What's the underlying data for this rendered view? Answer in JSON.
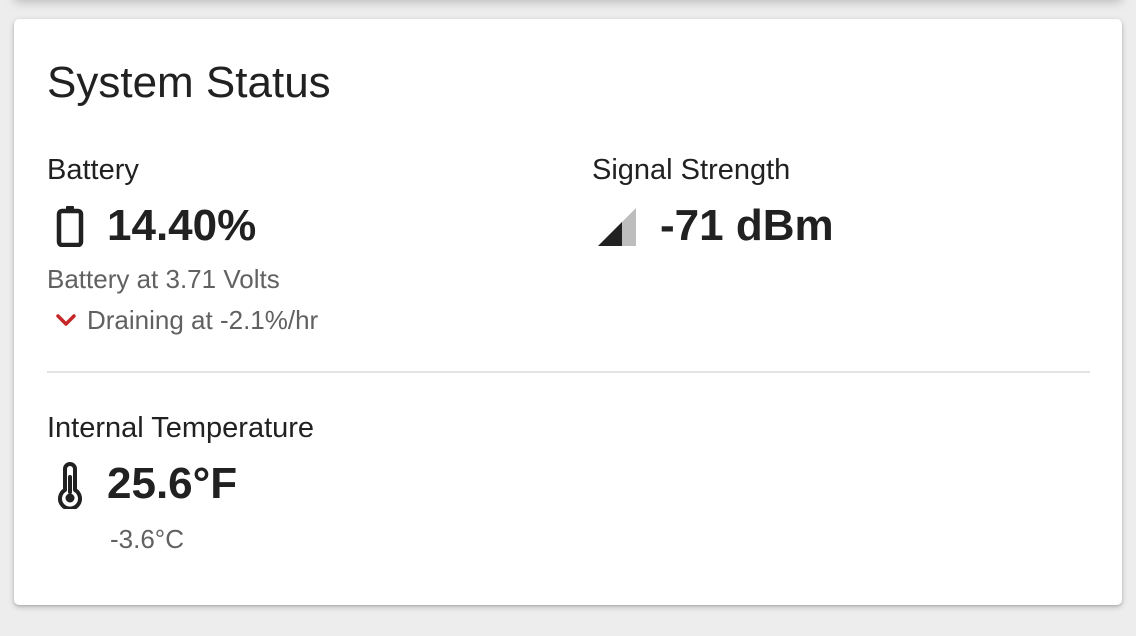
{
  "card": {
    "title": "System Status"
  },
  "battery": {
    "label": "Battery",
    "value": "14.40%",
    "voltage_text": "Battery at 3.71 Volts",
    "trend_text": "Draining at -2.1%/hr",
    "trend_direction": "down",
    "icon": "battery-icon",
    "trend_icon": "chevron-down-icon",
    "trend_color": "#c62828"
  },
  "signal": {
    "label": "Signal Strength",
    "value": "-71 dBm",
    "icon": "signal-icon"
  },
  "temperature": {
    "label": "Internal Temperature",
    "value": "25.6°F",
    "celsius": "-3.6°C",
    "icon": "thermometer-icon"
  }
}
